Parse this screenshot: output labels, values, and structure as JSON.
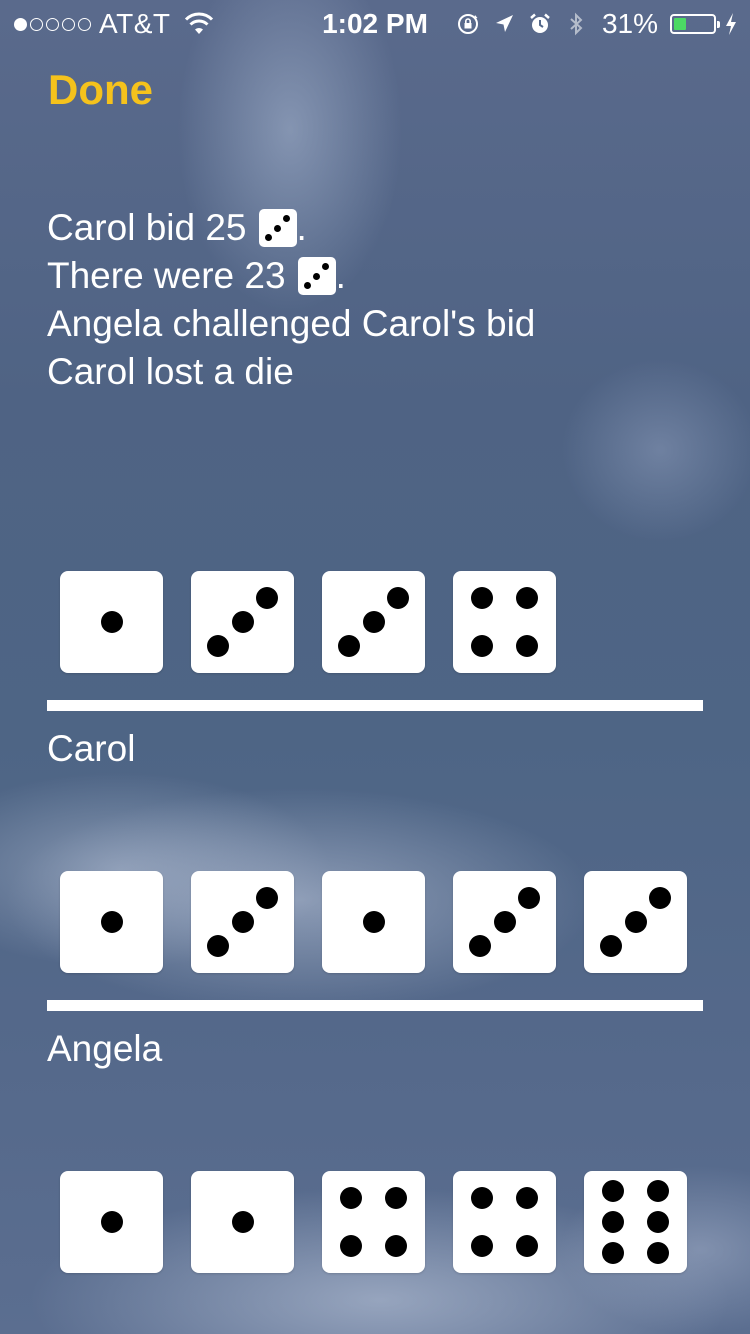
{
  "status_bar": {
    "signal_bars_filled": 1,
    "signal_bars_total": 5,
    "carrier": "AT&T",
    "time": "1:02 PM",
    "battery_percent": "31%",
    "battery_level": 0.31,
    "battery_color": "#4cd964",
    "icons": [
      "wifi-icon",
      "rotation-lock-icon",
      "location-arrow-icon",
      "alarm-icon",
      "bluetooth-icon",
      "battery-icon",
      "charging-bolt-icon"
    ]
  },
  "done_label": "Done",
  "accent_color": "#f5c21c",
  "summary": {
    "line1": {
      "text": "Carol bid 25",
      "die_face": 3,
      "suffix": "."
    },
    "line2": {
      "text": "There were 23",
      "die_face": 3,
      "suffix": "."
    },
    "line3": "Angela challenged Carol's bid",
    "line4": "Carol lost a die"
  },
  "rows": [
    {
      "player": "",
      "dice": [
        1,
        3,
        3,
        4
      ]
    },
    {
      "player": "Carol",
      "dice": [
        1,
        3,
        1,
        3,
        3
      ]
    },
    {
      "player": "Angela",
      "dice": [
        1,
        1,
        4,
        4,
        6
      ]
    }
  ]
}
